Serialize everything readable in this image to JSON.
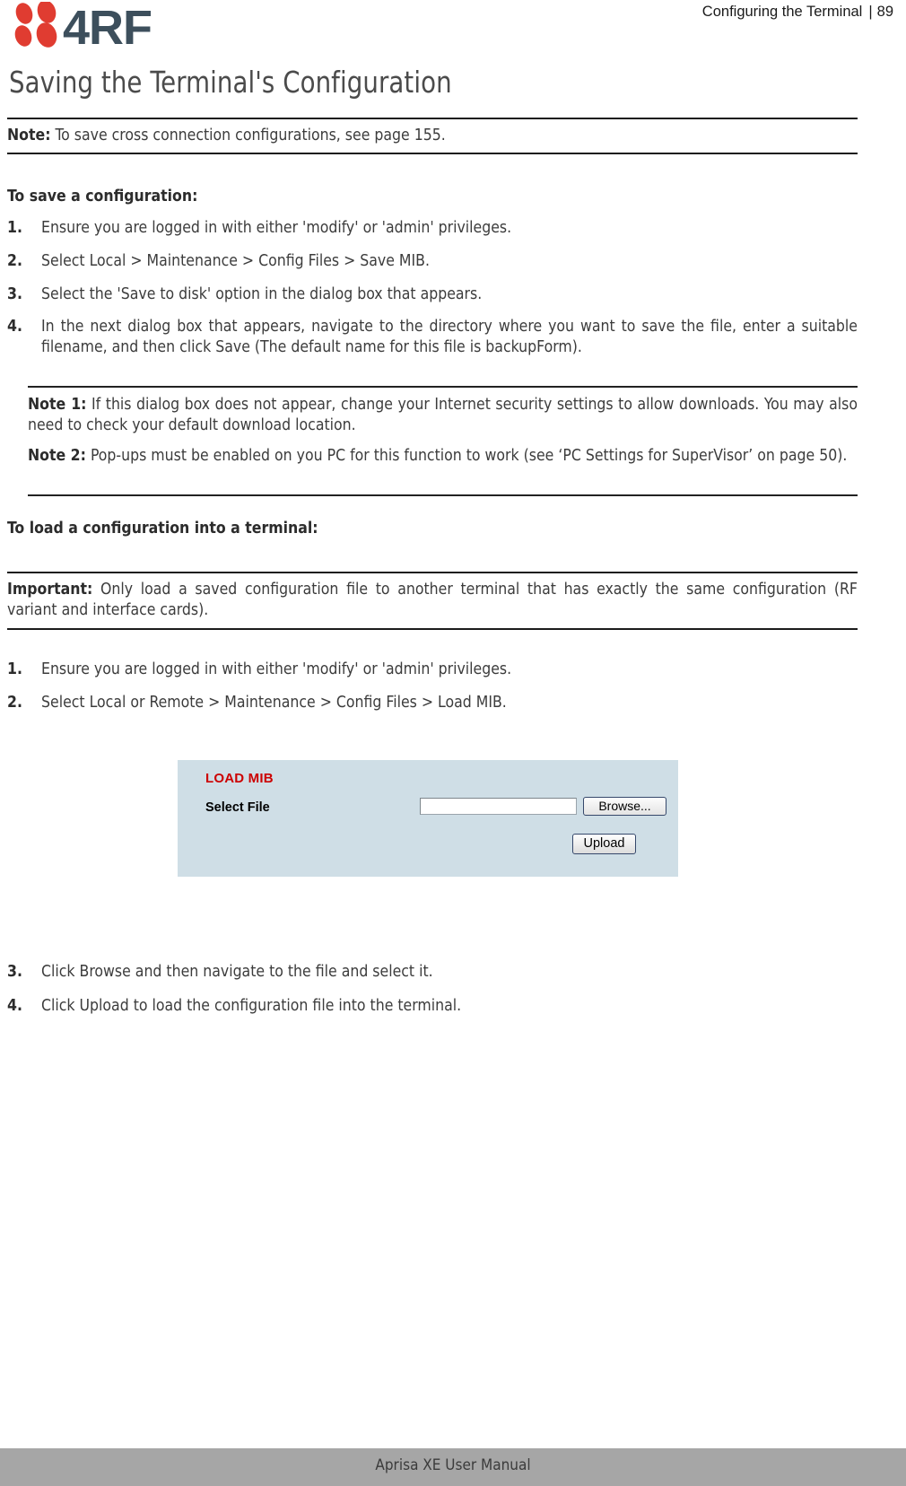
{
  "header": {
    "logo_text": "4RF",
    "logo_icon": "four-dots-logo-icon",
    "breadcrumb": "Configuring the Terminal",
    "separator": "|",
    "page_number": "89",
    "logo_red": "#e03c31",
    "logo_dark": "#3d4f5c"
  },
  "title": "Saving the Terminal's Configuration",
  "top_note": {
    "label": "Note:",
    "text": "To save cross connection configurations, see page 155."
  },
  "save_section": {
    "heading": "To save a configuration:",
    "steps": [
      {
        "num": "1.",
        "text": "Ensure you are logged in with either 'modify' or 'admin' privileges."
      },
      {
        "num": "2.",
        "text": "Select Local > Maintenance > Config Files > Save MIB."
      },
      {
        "num": "3.",
        "text": "Select the 'Save to disk' option in the dialog box that appears."
      },
      {
        "num": "4.",
        "text": "In the next dialog box that appears, navigate to the directory where you want to save the file, enter a suitable filename, and then click Save (The default name for this file is backupForm)."
      }
    ]
  },
  "notes": [
    {
      "label": "Note 1:",
      "text": "If this dialog box does not appear, change your Internet security settings to allow downloads. You may also need to check your default download location."
    },
    {
      "label": "Note 2:",
      "text": "Pop-ups must be enabled on you PC for this function to work (see ‘PC Settings for SuperVisor’ on page 50)."
    }
  ],
  "load_section": {
    "heading": "To load a configuration into a terminal:",
    "important": {
      "label": "Important:",
      "text": "Only load a saved configuration file to another terminal that has exactly the same configuration (RF variant and interface cards)."
    },
    "steps_before_image": [
      {
        "num": "1.",
        "text": "Ensure you are logged in with either 'modify' or 'admin' privileges."
      },
      {
        "num": "2.",
        "text": "Select Local or Remote > Maintenance > Config Files > Load MIB."
      }
    ],
    "steps_after_image": [
      {
        "num": "3.",
        "text": "Click Browse and then navigate to the file and select it."
      },
      {
        "num": "4.",
        "text": "Click Upload to load the configuration file into the terminal."
      }
    ]
  },
  "mib_panel": {
    "title": "LOAD MIB",
    "select_file_label": "Select File",
    "select_file_value": "",
    "browse_label": "Browse...",
    "upload_label": "Upload",
    "panel_bg": "#cfdee6",
    "title_color": "#cc0000"
  },
  "footer": {
    "text": "Aprisa XE User Manual",
    "bg": "#a6a6a6"
  }
}
